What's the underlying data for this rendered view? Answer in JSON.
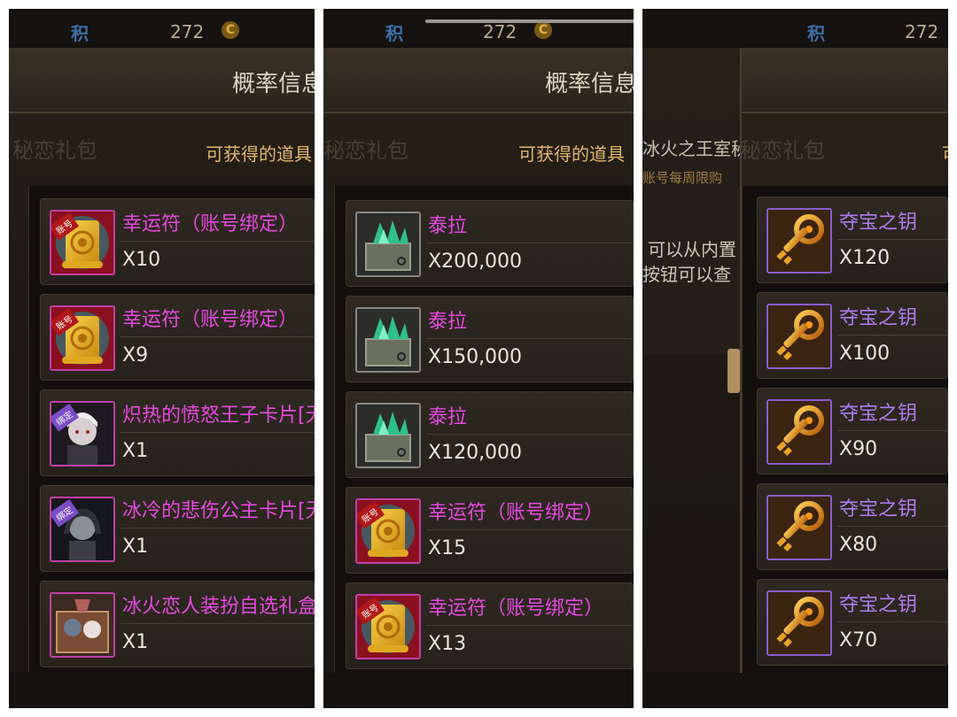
{
  "colors": {
    "magenta_item": "#e64ae0",
    "purple_item": "#b07cf0",
    "subhead": "#e2b66c",
    "title": "#ded4c0"
  },
  "panels": [
    {
      "header": {
        "label": "积",
        "points": "272",
        "coin_icon": "currency-coin-icon"
      },
      "title": "概率信息",
      "ghost_text": "秘恋礼包",
      "subheading": "可获得的道具",
      "items": [
        {
          "name": "幸运符（账号绑定）",
          "qty": "X10",
          "icon": "lucky-charm-scroll-icon",
          "tag": "账号"
        },
        {
          "name": "幸运符（账号绑定）",
          "qty": "X9",
          "icon": "lucky-charm-scroll-icon",
          "tag": "账号"
        },
        {
          "name": "炽热的愤怒王子卡片[无",
          "qty": "X1",
          "icon": "prince-card-icon",
          "tag": "绑定"
        },
        {
          "name": "冰冷的悲伤公主卡片[无",
          "qty": "X1",
          "icon": "princess-card-icon",
          "tag": "绑定"
        },
        {
          "name": "冰火恋人装扮自选礼盒",
          "qty": "X1",
          "icon": "costume-gift-box-icon",
          "tag": ""
        }
      ]
    },
    {
      "header": {
        "label": "积",
        "points": "272",
        "coin_icon": "currency-coin-icon"
      },
      "title": "概率信息",
      "ghost_text": "秘恋礼包",
      "subheading": "可获得的道具",
      "items": [
        {
          "name": "泰拉",
          "qty": "X200,000",
          "icon": "tera-crystal-chest-icon",
          "tag": ""
        },
        {
          "name": "泰拉",
          "qty": "X150,000",
          "icon": "tera-crystal-chest-icon",
          "tag": ""
        },
        {
          "name": "泰拉",
          "qty": "X120,000",
          "icon": "tera-crystal-chest-icon",
          "tag": ""
        },
        {
          "name": "幸运符（账号绑定）",
          "qty": "X15",
          "icon": "lucky-charm-scroll-icon",
          "tag": "账号"
        },
        {
          "name": "幸运符（账号绑定）",
          "qty": "X13",
          "icon": "lucky-charm-scroll-icon",
          "tag": "账号"
        }
      ]
    },
    {
      "header": {
        "label": "积",
        "points": "272",
        "coin_icon": "currency-coin-icon"
      },
      "bg_title": "冰火之王室秘恋礼包",
      "bg_limit": "账号每周限购",
      "bg_text_1": "可以从内置",
      "bg_text_2": "按钮可以查",
      "subheading": "可",
      "items": [
        {
          "name": "夺宝之钥",
          "qty": "X120",
          "icon": "treasure-key-icon"
        },
        {
          "name": "夺宝之钥",
          "qty": "X100",
          "icon": "treasure-key-icon"
        },
        {
          "name": "夺宝之钥",
          "qty": "X90",
          "icon": "treasure-key-icon"
        },
        {
          "name": "夺宝之钥",
          "qty": "X80",
          "icon": "treasure-key-icon"
        },
        {
          "name": "夺宝之钥",
          "qty": "X70",
          "icon": "treasure-key-icon"
        }
      ]
    }
  ]
}
